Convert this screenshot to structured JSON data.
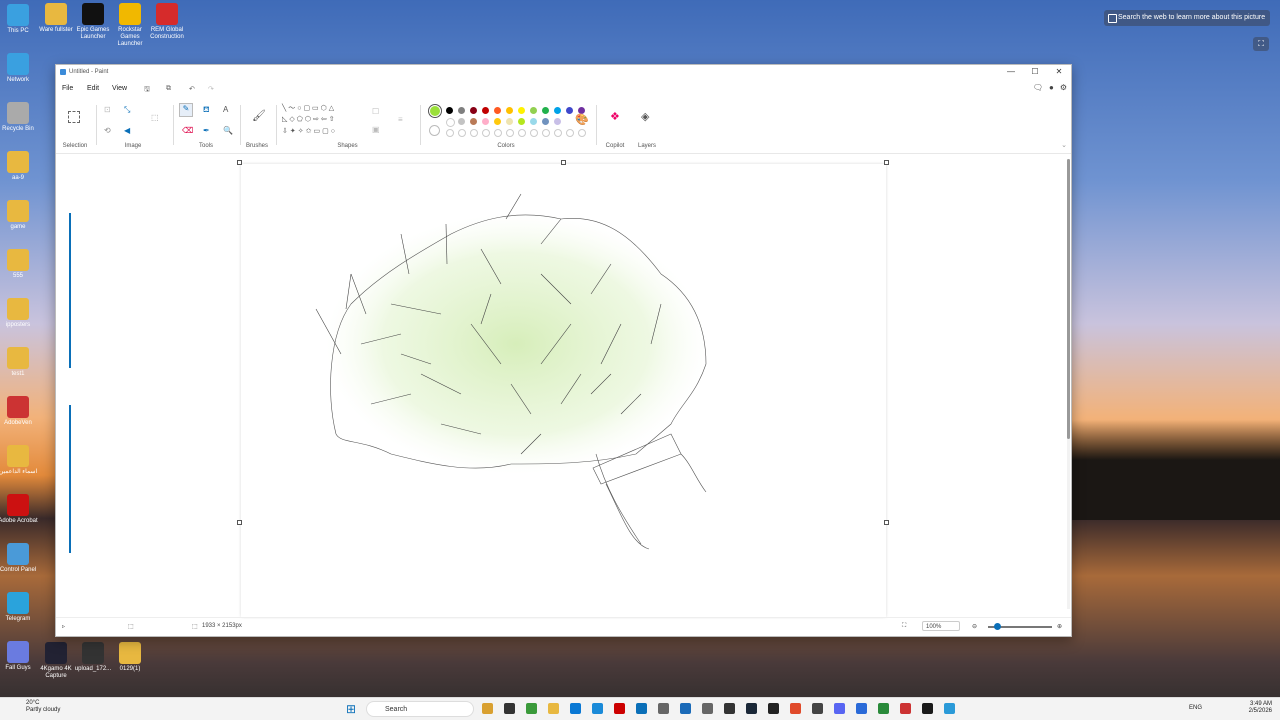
{
  "desktop": {
    "icons_left": [
      {
        "label": "This PC",
        "color": "#3aa0e0"
      },
      {
        "label": "Network",
        "color": "#3aa0e0"
      },
      {
        "label": "Recycle Bin",
        "color": "#aaa"
      },
      {
        "label": "aa-9",
        "color": "#e8b840"
      },
      {
        "label": "game",
        "color": "#e8b840"
      },
      {
        "label": "555",
        "color": "#e8b840"
      },
      {
        "label": "ipposters",
        "color": "#e8b840"
      },
      {
        "label": "test1",
        "color": "#e8b840"
      },
      {
        "label": "AdobeVen",
        "color": "#c33"
      },
      {
        "label": "اسماء الداعمين",
        "color": "#e8b840"
      },
      {
        "label": "Adobe Acrobat",
        "color": "#c11"
      },
      {
        "label": "Control Panel",
        "color": "#4a9ad8"
      },
      {
        "label": "Telegram",
        "color": "#2aa3dc"
      },
      {
        "label": "Fall Guys",
        "color": "#6a7be0"
      }
    ],
    "icons_top": [
      {
        "label": "Ware fullster",
        "color": "#e8b840"
      },
      {
        "label": "Epic Games Launcher",
        "color": "#111"
      },
      {
        "label": "Rockstar Games Launcher",
        "color": "#f1b800"
      },
      {
        "label": "REM Global Construction",
        "color": "#d62b2b"
      }
    ],
    "icons_bottom": [
      {
        "label": "4Kgamo 4K Capture",
        "color": "#223"
      },
      {
        "label": "upload_172...",
        "color": "#333"
      },
      {
        "label": "0129(1)",
        "color": "#e8b840"
      }
    ],
    "search_web": "Search the web to learn more about this picture"
  },
  "paint": {
    "title": "Untitled - Paint",
    "window_controls": [
      "—",
      "☐",
      "✕"
    ],
    "menu": [
      "File",
      "Edit",
      "View"
    ],
    "groups": {
      "selection": "Selection",
      "image": "Image",
      "tools": "Tools",
      "brushes": "Brushes",
      "shapes": "Shapes",
      "colors": "Colors",
      "copilot": "Copilot",
      "layers": "Layers"
    },
    "active_color": "#9be03a",
    "palette_row1": [
      "#000000",
      "#7f7f7f",
      "#880015",
      "#c00000",
      "#ff5a22",
      "#ffc000",
      "#fff200",
      "#92d050",
      "#22b14c",
      "#00a2e8",
      "#3f48cc",
      "#7030a0"
    ],
    "palette_row2": [
      "#ffffff",
      "#c3c3c3",
      "#b97a57",
      "#ffaec9",
      "#ffc90e",
      "#efe4b0",
      "#b5e61d",
      "#99d9ea",
      "#7092be",
      "#c8bfe7"
    ],
    "status": {
      "canvas_size": "1933 × 2153px",
      "zoom": "100%"
    }
  },
  "taskbar": {
    "weather_temp": "20°C",
    "weather_desc": "Partly cloudy",
    "search": "Search",
    "lang": "ENG",
    "time": "3:49 AM",
    "date": "2/5/2026"
  }
}
